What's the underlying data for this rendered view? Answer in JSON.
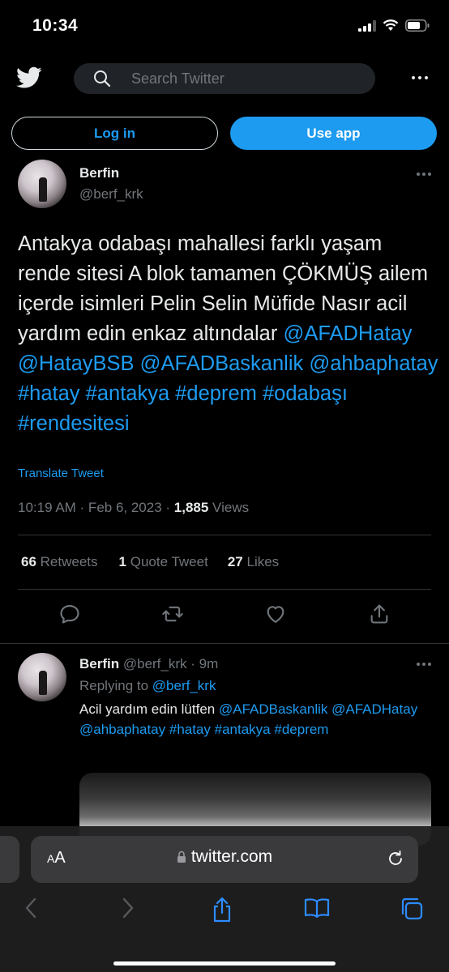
{
  "status_bar": {
    "time": "10:34"
  },
  "header": {
    "search_placeholder": "Search Twitter"
  },
  "auth": {
    "login_label": "Log in",
    "use_app_label": "Use app"
  },
  "tweet": {
    "author_name": "Berfin",
    "author_handle": "@berf_krk",
    "text_plain": "Antakya odabaşı mahallesi farklı yaşam rende sitesi A blok tamamen ÇÖKMÜŞ ailem içerde isimleri Pelin Selin Müfide Nasır acil yardım edin enkaz altındalar ",
    "mentions": [
      "@AFADHatay",
      "@HatayBSB",
      "@AFADBaskanlik",
      "@ahbaphatay",
      "#hatay",
      "#antakya",
      "#deprem",
      "#odabaşı",
      "#rendesitesi"
    ],
    "translate_label": "Translate Tweet",
    "timestamp": "10:19 AM · Feb 6, 2023 · ",
    "views_count": "1,885",
    "views_label": " Views",
    "stats": {
      "retweets_count": "66",
      "retweets_label": "Retweets",
      "quotes_count": "1",
      "quotes_label": "Quote Tweet",
      "likes_count": "27",
      "likes_label": "Likes"
    }
  },
  "reply": {
    "author_name": "Berfin",
    "author_handle": "@berf_krk · 9m",
    "replying_label": "Replying to ",
    "replying_to": "@berf_krk",
    "text_plain": "Acil yardım edin lütfen ",
    "mentions": [
      "@AFADBaskanlik",
      "@AFADHatay",
      "@ahbaphatay",
      "#hatay",
      "#antakya",
      "#deprem"
    ]
  },
  "safari": {
    "aa_label": "AA",
    "url": "twitter.com"
  },
  "colors": {
    "accent": "#1d9bf0",
    "background": "#000000",
    "muted": "#71767b"
  },
  "icons": [
    "twitter-bird-icon",
    "search-icon",
    "reply-icon",
    "retweet-icon",
    "like-icon",
    "share-icon",
    "lock-icon",
    "reload-icon",
    "back-icon",
    "forward-icon",
    "share-sheet-icon",
    "bookmarks-icon",
    "tabs-icon"
  ]
}
